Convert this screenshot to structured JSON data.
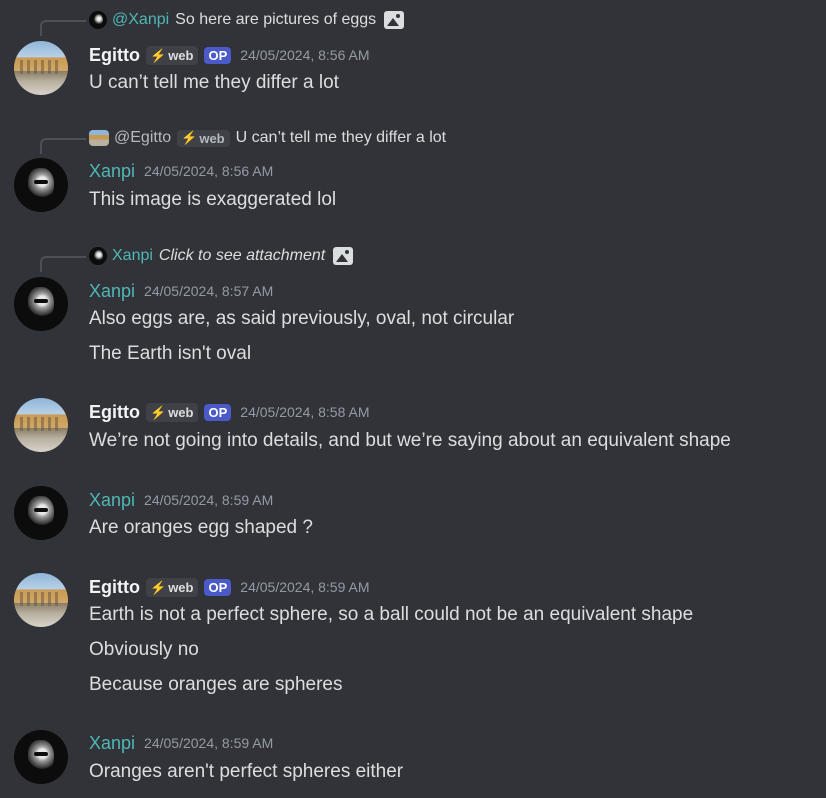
{
  "messages": [
    {
      "reply": {
        "name": "@Xanpi",
        "text": "So here are pictures of eggs"
      },
      "author": "Egitto",
      "web_badge": "web",
      "op_badge": "OP",
      "timestamp": "24/05/2024, 8:56 AM",
      "lines": [
        "U can’t tell me they differ a lot"
      ]
    },
    {
      "reply": {
        "name": "@Egitto",
        "badge": "web",
        "text": "U can’t tell me they differ a lot"
      },
      "author": "Xanpi",
      "timestamp": "24/05/2024, 8:56 AM",
      "lines": [
        "This image is exaggerated lol"
      ]
    },
    {
      "reply": {
        "name": "Xanpi",
        "text": "Click to see attachment"
      },
      "author": "Xanpi",
      "timestamp": "24/05/2024, 8:57 AM",
      "lines": [
        "Also eggs are, as said previously, oval, not circular",
        "The Earth isn't oval"
      ]
    },
    {
      "author": "Egitto",
      "web_badge": "web",
      "op_badge": "OP",
      "timestamp": "24/05/2024, 8:58 AM",
      "lines": [
        "We’re not going into details, and but we’re saying about an equivalent shape"
      ]
    },
    {
      "author": "Xanpi",
      "timestamp": "24/05/2024, 8:59 AM",
      "lines": [
        "Are oranges egg shaped ?"
      ]
    },
    {
      "author": "Egitto",
      "web_badge": "web",
      "op_badge": "OP",
      "timestamp": "24/05/2024, 8:59 AM",
      "lines": [
        "Earth is not a perfect sphere, so a ball could not be an equivalent shape",
        "Obviously no",
        "Because oranges are spheres"
      ]
    },
    {
      "author": "Xanpi",
      "timestamp": "24/05/2024, 8:59 AM",
      "lines": [
        "Oranges aren't perfect spheres either"
      ]
    }
  ],
  "icons": {
    "bolt": "⚡",
    "image": "image-icon"
  },
  "colors": {
    "background": "#313338",
    "xanpi_name": "#4fb7b5",
    "op_badge": "#4c5ac9",
    "web_badge": "#3f4147",
    "timestamp": "#949ba4"
  }
}
